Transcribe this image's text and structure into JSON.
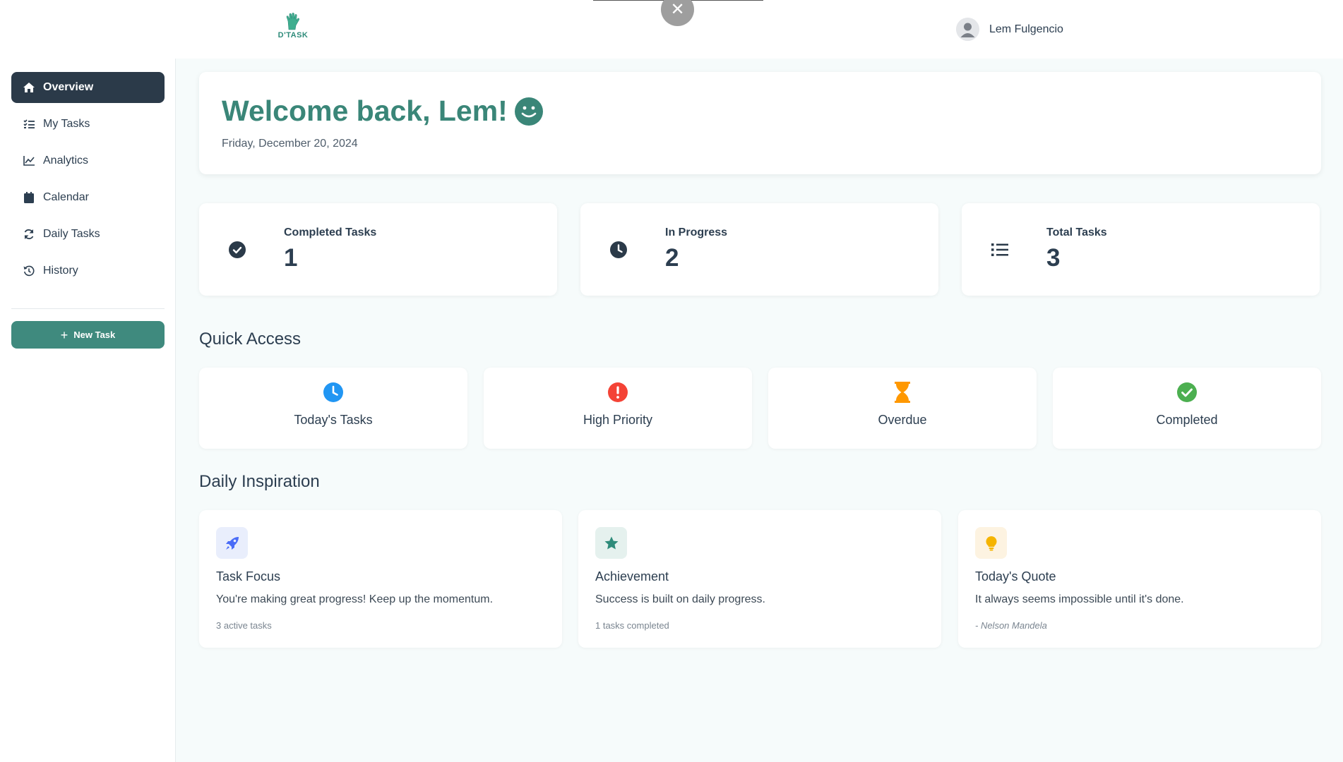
{
  "app": {
    "logo_text": "D'TASK"
  },
  "header": {
    "user_name": "Lem Fulgencio"
  },
  "sidebar": {
    "items": [
      {
        "label": "Overview",
        "icon": "home-icon",
        "active": true
      },
      {
        "label": "My Tasks",
        "icon": "tasks-list-icon",
        "active": false
      },
      {
        "label": "Analytics",
        "icon": "chart-line-icon",
        "active": false
      },
      {
        "label": "Calendar",
        "icon": "calendar-icon",
        "active": false
      },
      {
        "label": "Daily Tasks",
        "icon": "refresh-icon",
        "active": false
      },
      {
        "label": "History",
        "icon": "history-icon",
        "active": false
      }
    ],
    "new_task_label": "New Task"
  },
  "welcome": {
    "title": "Welcome back, Lem!",
    "date": "Friday, December 20, 2024"
  },
  "stats": [
    {
      "label": "Completed Tasks",
      "value": "1",
      "icon": "check-circle-icon"
    },
    {
      "label": "In Progress",
      "value": "2",
      "icon": "clock-icon"
    },
    {
      "label": "Total Tasks",
      "value": "3",
      "icon": "list-icon"
    }
  ],
  "quick_access": {
    "title": "Quick Access",
    "items": [
      {
        "label": "Today's Tasks",
        "icon": "clock-icon",
        "color": "#2196f3"
      },
      {
        "label": "High Priority",
        "icon": "exclamation-icon",
        "color": "#f44336"
      },
      {
        "label": "Overdue",
        "icon": "hourglass-icon",
        "color": "#ff9800"
      },
      {
        "label": "Completed",
        "icon": "check-circle-icon",
        "color": "#4caf50"
      }
    ]
  },
  "inspiration": {
    "title": "Daily Inspiration",
    "cards": [
      {
        "title": "Task Focus",
        "text": "You're making great progress! Keep up the momentum.",
        "footer": "3 active tasks",
        "icon": "rocket-icon",
        "color": "#4a6cf7"
      },
      {
        "title": "Achievement",
        "text": "Success is built on daily progress.",
        "footer": "1 tasks completed",
        "icon": "star-icon",
        "color": "#2e8b7a"
      },
      {
        "title": "Today's Quote",
        "text": "It always seems impossible until it's done.",
        "footer": "- Nelson Mandela",
        "icon": "lightbulb-icon",
        "color": "#f5b400"
      }
    ]
  },
  "colors": {
    "accent": "#3a8678",
    "sidebar_active": "#2b3a49",
    "button": "#3f8a7e"
  }
}
